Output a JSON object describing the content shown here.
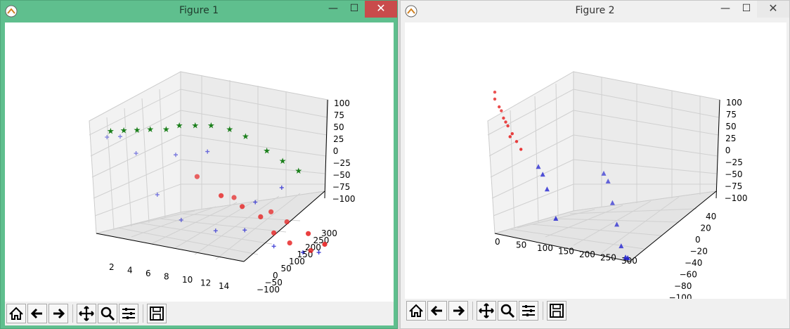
{
  "windows": [
    {
      "title": "Figure 1",
      "buttons": {
        "minimize": "—",
        "maximize": "☐",
        "close": "✕"
      },
      "axes": {
        "x_ticks": [
          "2",
          "4",
          "6",
          "8",
          "10",
          "12",
          "14"
        ],
        "y_ticks": [
          "−100",
          "−50",
          "0",
          "50",
          "100",
          "150",
          "200",
          "250",
          "300"
        ],
        "z_ticks": [
          "100",
          "75",
          "50",
          "25",
          "0",
          "−25",
          "−50",
          "−75",
          "−100"
        ]
      }
    },
    {
      "title": "Figure 2",
      "buttons": {
        "minimize": "—",
        "maximize": "☐",
        "close": "✕"
      },
      "axes": {
        "x_ticks": [
          "0",
          "50",
          "100",
          "150",
          "200",
          "250",
          "300"
        ],
        "y_ticks": [
          "40",
          "20",
          "0",
          "−20",
          "−40",
          "−60",
          "−80",
          "−100"
        ],
        "z_ticks": [
          "100",
          "75",
          "50",
          "25",
          "0",
          "−25",
          "−50",
          "−75",
          "−100"
        ]
      }
    }
  ],
  "toolbar_icons": [
    "home-icon",
    "back-arrow-icon",
    "forward-arrow-icon",
    "pan-icon",
    "zoom-icon",
    "configure-subplots-icon",
    "save-icon"
  ],
  "colors": {
    "red": "#e61e1e",
    "green": "#1a7f1a",
    "blue": "#1f1fcf",
    "win1_title": "#5fbf8e"
  },
  "chart_data": [
    {
      "type": "scatter",
      "title": "",
      "dimensions": 3,
      "series": [
        {
          "marker": "o",
          "color": "red",
          "values": [
            [
              6,
              30,
              -40
            ],
            [
              8,
              30,
              -50
            ],
            [
              10,
              40,
              -60
            ],
            [
              11,
              30,
              -80
            ],
            [
              12,
              10,
              -90
            ],
            [
              13,
              -20,
              -70
            ],
            [
              14,
              -50,
              -80
            ],
            [
              6,
              120,
              -20
            ],
            [
              9,
              100,
              -40
            ],
            [
              12,
              80,
              -50
            ],
            [
              14,
              10,
              -95
            ],
            [
              13,
              60,
              -60
            ]
          ]
        },
        {
          "marker": "*",
          "color": "green",
          "values": [
            [
              1,
              250,
              20
            ],
            [
              2,
              240,
              25
            ],
            [
              3,
              230,
              30
            ],
            [
              4,
              220,
              35
            ],
            [
              5,
              200,
              40
            ],
            [
              6,
              190,
              50
            ],
            [
              7,
              170,
              55
            ],
            [
              8,
              150,
              60
            ],
            [
              9,
              120,
              60
            ],
            [
              10,
              100,
              55
            ],
            [
              11,
              60,
              40
            ],
            [
              12,
              40,
              30
            ],
            [
              13,
              20,
              20
            ]
          ]
        },
        {
          "marker": "+",
          "color": "blue",
          "values": [
            [
              1,
              260,
              10
            ],
            [
              2,
              250,
              15
            ],
            [
              3,
              230,
              -5
            ],
            [
              4,
              190,
              -60
            ],
            [
              5,
              140,
              -90
            ],
            [
              7,
              90,
              -95
            ],
            [
              9,
              60,
              -85
            ],
            [
              11,
              30,
              -100
            ],
            [
              13,
              0,
              -100
            ],
            [
              14,
              -20,
              -95
            ],
            [
              6,
              200,
              5
            ],
            [
              8,
              160,
              20
            ],
            [
              10,
              60,
              -40
            ],
            [
              12,
              40,
              -10
            ]
          ]
        }
      ]
    },
    {
      "type": "scatter",
      "title": "",
      "dimensions": 3,
      "series": [
        {
          "marker": "o",
          "color": "red",
          "values": [
            [
              0,
              -50,
              95
            ],
            [
              10,
              -55,
              85
            ],
            [
              20,
              -60,
              70
            ],
            [
              30,
              -60,
              60
            ],
            [
              40,
              -70,
              50
            ],
            [
              50,
              -70,
              40
            ],
            [
              60,
              -80,
              30
            ],
            [
              0,
              -40,
              105
            ],
            [
              15,
              -45,
              80
            ],
            [
              25,
              -65,
              65
            ],
            [
              35,
              -75,
              45
            ]
          ]
        },
        {
          "marker": "^",
          "color": "blue",
          "values": [
            [
              100,
              -40,
              10
            ],
            [
              110,
              -45,
              0
            ],
            [
              120,
              -50,
              -20
            ],
            [
              140,
              -60,
              -60
            ],
            [
              250,
              -10,
              20
            ],
            [
              260,
              -15,
              10
            ],
            [
              270,
              -20,
              -20
            ],
            [
              280,
              -30,
              -50
            ],
            [
              290,
              -50,
              -80
            ],
            [
              300,
              -70,
              -95
            ],
            [
              305,
              -80,
              -100
            ]
          ]
        }
      ]
    }
  ]
}
